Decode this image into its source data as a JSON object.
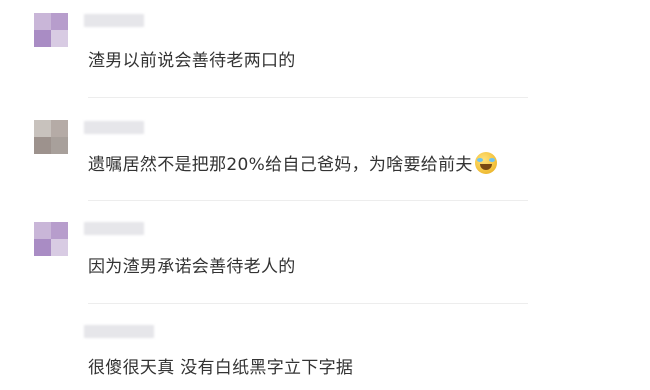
{
  "comments": [
    {
      "text": "渣男以前说会善待老两口的",
      "avatar_colors": [
        "#c9b6d8",
        "#b79dcc",
        "#a98cc4",
        "#d8cbe3"
      ]
    },
    {
      "text": "遗嘱居然不是把那20%给自己爸妈，为啥要给前夫",
      "emoji": "crying-laughing-face",
      "avatar_colors": [
        "#c8c2bd",
        "#b5aba6",
        "#9d928d",
        "#a8a09b"
      ]
    },
    {
      "text": "因为渣男承诺会善待老人的",
      "avatar_colors": [
        "#c9b6d8",
        "#b79dcc",
        "#a98cc4",
        "#d8cbe3"
      ]
    },
    {
      "text": "很傻很天真 没有白纸黑字立下字据"
    }
  ]
}
